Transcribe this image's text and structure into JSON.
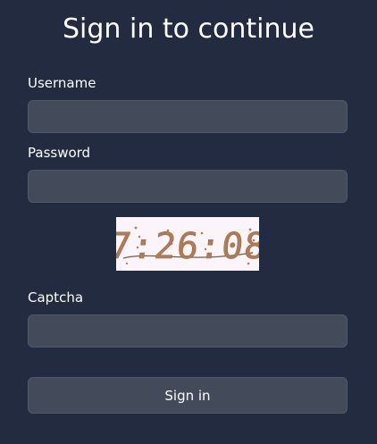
{
  "form": {
    "title": "Sign in to continue",
    "username": {
      "label": "Username",
      "value": "",
      "placeholder": ""
    },
    "password": {
      "label": "Password",
      "value": "",
      "placeholder": ""
    },
    "captcha": {
      "image_text": "7:26:08",
      "label": "Captcha",
      "value": "",
      "placeholder": ""
    },
    "submit_label": "Sign in"
  },
  "colors": {
    "background": "#222b40",
    "input_background": "#434a5a",
    "captcha_background": "#fbf5fa",
    "captcha_ink": "#b07c58",
    "text": "#ffffff"
  }
}
